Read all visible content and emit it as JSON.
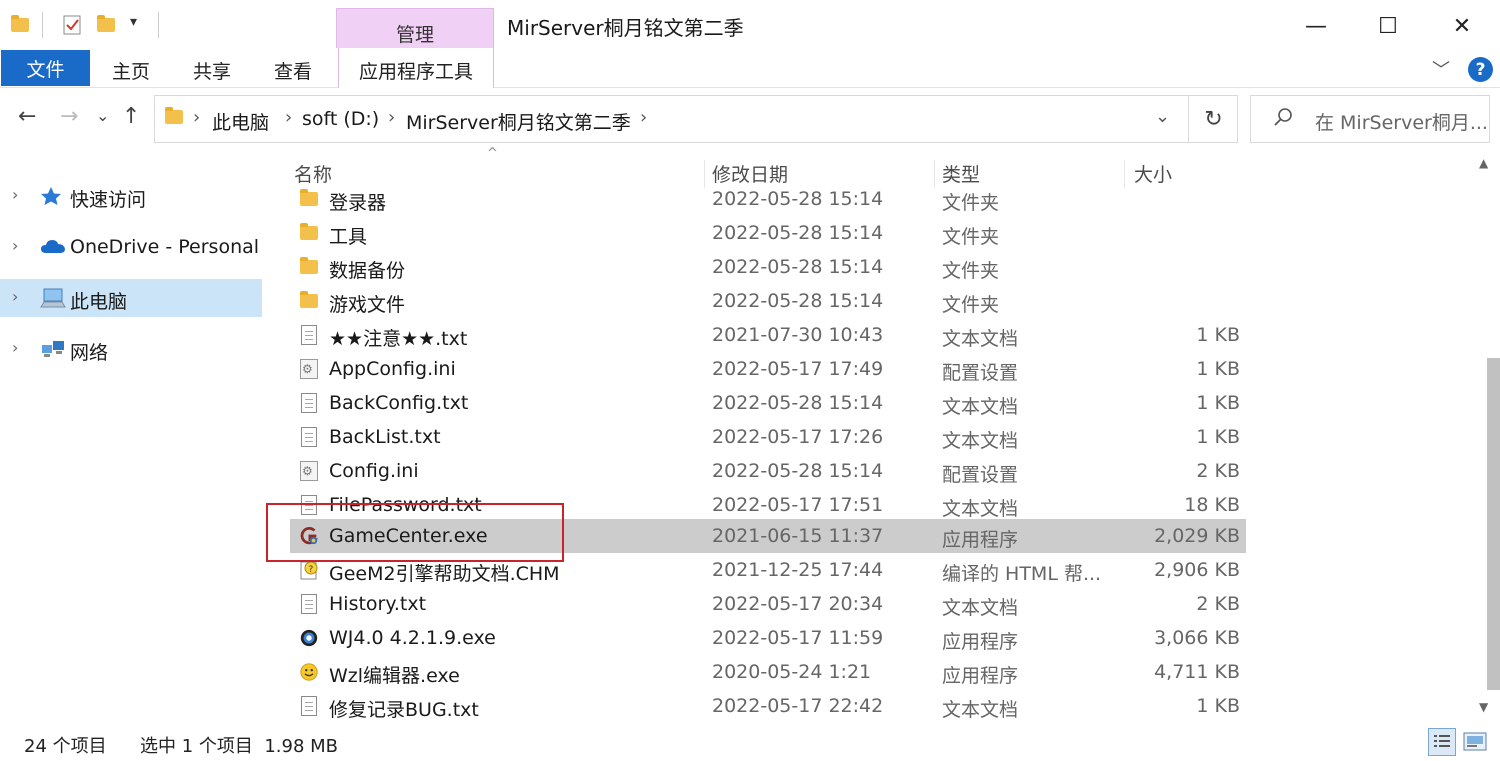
{
  "window": {
    "title": "MirServer桐月铭文第二季",
    "manage_tab": "管理",
    "minimize": "—",
    "maximize": "☐",
    "close": "✕"
  },
  "ribbon": {
    "file": "文件",
    "home": "主页",
    "share": "共享",
    "view": "查看",
    "app_tools": "应用程序工具",
    "collapse": "﹀",
    "help": "?"
  },
  "address": {
    "back": "←",
    "forward": "→",
    "recent": "⌄",
    "up": "↑",
    "crumbs": [
      "此电脑",
      "soft (D:)",
      "MirServer桐月铭文第二季"
    ],
    "sep": "›",
    "dropdown": "⌄",
    "refresh": "↻"
  },
  "search": {
    "placeholder": "在 MirServer桐月...",
    "icon": "search-icon"
  },
  "sidebar": {
    "items": [
      {
        "label": "快速访问",
        "icon": "star-icon",
        "selected": false
      },
      {
        "label": "OneDrive - Personal",
        "icon": "cloud-icon",
        "selected": false
      },
      {
        "label": "此电脑",
        "icon": "computer-icon",
        "selected": true
      },
      {
        "label": "网络",
        "icon": "network-icon",
        "selected": false
      }
    ],
    "arrow": "›"
  },
  "columns": {
    "name": "名称",
    "date": "修改日期",
    "type": "类型",
    "size": "大小",
    "sort_indicator": "^"
  },
  "files": [
    {
      "name": "登录器",
      "date": "2022-05-28 15:14",
      "type": "文件夹",
      "size": "",
      "icon": "folder-icon"
    },
    {
      "name": "工具",
      "date": "2022-05-28 15:14",
      "type": "文件夹",
      "size": "",
      "icon": "folder-icon"
    },
    {
      "name": "数据备份",
      "date": "2022-05-28 15:14",
      "type": "文件夹",
      "size": "",
      "icon": "folder-icon"
    },
    {
      "name": "游戏文件",
      "date": "2022-05-28 15:14",
      "type": "文件夹",
      "size": "",
      "icon": "folder-icon"
    },
    {
      "name": "★★注意★★.txt",
      "date": "2021-07-30 10:43",
      "type": "文本文档",
      "size": "1 KB",
      "icon": "text-file-icon"
    },
    {
      "name": "AppConfig.ini",
      "date": "2022-05-17 17:49",
      "type": "配置设置",
      "size": "1 KB",
      "icon": "config-file-icon"
    },
    {
      "name": "BackConfig.txt",
      "date": "2022-05-28 15:14",
      "type": "文本文档",
      "size": "1 KB",
      "icon": "text-file-icon"
    },
    {
      "name": "BackList.txt",
      "date": "2022-05-17 17:26",
      "type": "文本文档",
      "size": "1 KB",
      "icon": "text-file-icon"
    },
    {
      "name": "Config.ini",
      "date": "2022-05-28 15:14",
      "type": "配置设置",
      "size": "2 KB",
      "icon": "config-file-icon"
    },
    {
      "name": "FilePassword.txt",
      "date": "2022-05-17 17:51",
      "type": "文本文档",
      "size": "18 KB",
      "icon": "text-file-icon"
    },
    {
      "name": "GameCenter.exe",
      "date": "2021-06-15 11:37",
      "type": "应用程序",
      "size": "2,029 KB",
      "icon": "gamecenter-app-icon",
      "selected": true
    },
    {
      "name": "GeeM2引擎帮助文档.CHM",
      "date": "2021-12-25 17:44",
      "type": "编译的 HTML 帮...",
      "size": "2,906 KB",
      "icon": "help-file-icon"
    },
    {
      "name": "History.txt",
      "date": "2022-05-17 20:34",
      "type": "文本文档",
      "size": "2 KB",
      "icon": "text-file-icon"
    },
    {
      "name": "WJ4.0 4.2.1.9.exe",
      "date": "2022-05-17 11:59",
      "type": "应用程序",
      "size": "3,066 KB",
      "icon": "wj-app-icon"
    },
    {
      "name": "Wzl编辑器.exe",
      "date": "2020-05-24 1:21",
      "type": "应用程序",
      "size": "4,711 KB",
      "icon": "smiley-app-icon"
    },
    {
      "name": "修复记录BUG.txt",
      "date": "2022-05-17 22:42",
      "type": "文本文档",
      "size": "1 KB",
      "icon": "text-file-icon"
    }
  ],
  "scroll": {
    "up": "▲",
    "down": "▼"
  },
  "status": {
    "count": "24 个项目",
    "selection": "选中 1 个项目  1.98 MB"
  },
  "colors": {
    "accent": "#1a6ac8",
    "manage_tab": "#f0d0f4",
    "selected_row": "#cccccc",
    "sidebar_selected": "#cce4f7",
    "highlight": "#c9242b"
  }
}
